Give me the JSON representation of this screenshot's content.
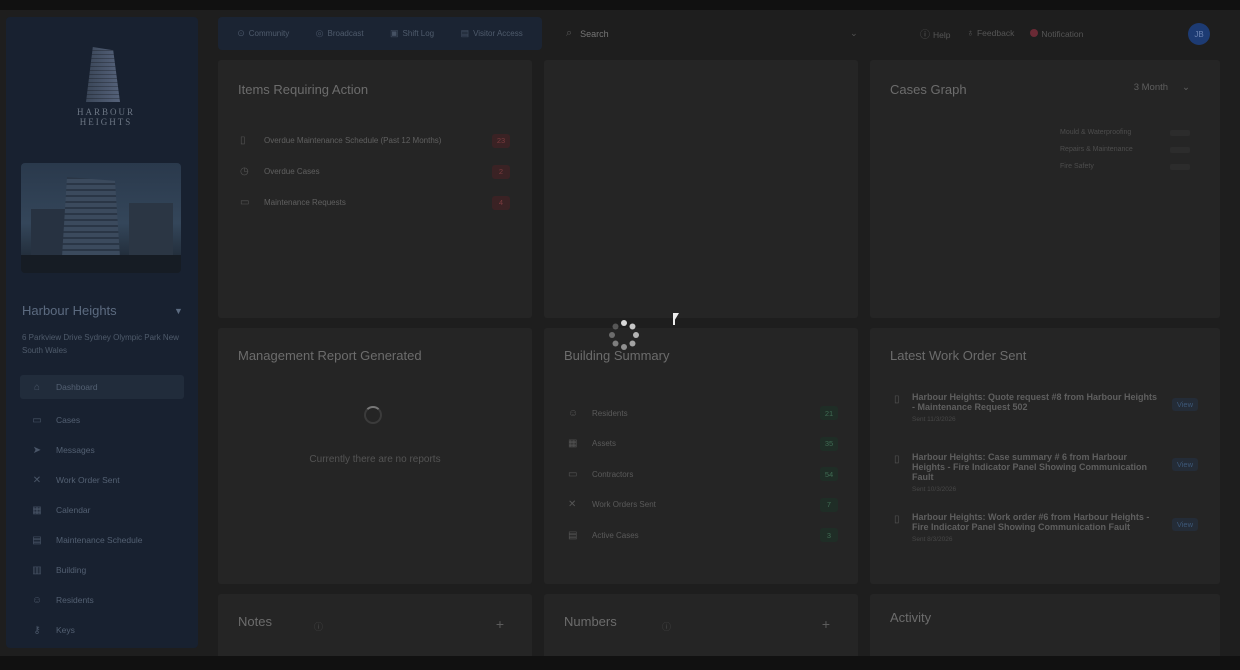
{
  "sidebar": {
    "brand_text": "HARBOUR HEIGHTS",
    "building_name": "Harbour Heights",
    "address": "6 Parkview Drive Sydney Olympic Park New South Wales",
    "items": [
      {
        "label": "Dashboard",
        "icon": "dashboard-icon",
        "glyph": "⌂"
      },
      {
        "label": "Cases",
        "icon": "briefcase-icon",
        "glyph": "▭"
      },
      {
        "label": "Messages",
        "icon": "send-icon",
        "glyph": "➤"
      },
      {
        "label": "Work Order Sent",
        "icon": "tools-icon",
        "glyph": "✕"
      },
      {
        "label": "Calendar",
        "icon": "calendar-icon",
        "glyph": "▦"
      },
      {
        "label": "Maintenance Schedule",
        "icon": "schedule-icon",
        "glyph": "▤"
      },
      {
        "label": "Building",
        "icon": "building-icon",
        "glyph": "▥"
      },
      {
        "label": "Residents",
        "icon": "residents-icon",
        "glyph": "☺"
      },
      {
        "label": "Keys",
        "icon": "key-icon",
        "glyph": "⚷"
      }
    ]
  },
  "toolbar": {
    "items": [
      {
        "label": "Community",
        "icon": "community-icon",
        "glyph": "⊙"
      },
      {
        "label": "Broadcast",
        "icon": "broadcast-icon",
        "glyph": "◎"
      },
      {
        "label": "Shift Log",
        "icon": "shift-log-icon",
        "glyph": "▣"
      },
      {
        "label": "Visitor Access",
        "icon": "visitor-icon",
        "glyph": "▤"
      }
    ]
  },
  "search": {
    "placeholder": "Search"
  },
  "topbar": {
    "help": "Help",
    "feedback": "Feedback",
    "notification": "Notification",
    "avatar_initials": "JB"
  },
  "items_requiring_action": {
    "title": "Items Requiring Action",
    "rows": [
      {
        "label": "Overdue Maintenance Schedule (Past 12 Months)",
        "count": "23",
        "icon": "document-icon",
        "glyph": "▯"
      },
      {
        "label": "Overdue Cases",
        "count": "2",
        "icon": "alarm-icon",
        "glyph": "◷"
      },
      {
        "label": "Maintenance Requests",
        "count": "4",
        "icon": "inbox-icon",
        "glyph": "▭"
      }
    ]
  },
  "cases_graph": {
    "title": "Cases Graph",
    "range": "3 Month",
    "legend": [
      "Mould & Waterproofing",
      "Repairs & Maintenance",
      "Fire Safety"
    ]
  },
  "management_report": {
    "title": "Management Report Generated",
    "empty": "Currently there are no reports"
  },
  "building_summary": {
    "title": "Building Summary",
    "rows": [
      {
        "label": "Residents",
        "count": "21",
        "icon": "residents-icon",
        "glyph": "☺"
      },
      {
        "label": "Assets",
        "count": "35",
        "icon": "assets-icon",
        "glyph": "▦"
      },
      {
        "label": "Contractors",
        "count": "54",
        "icon": "contractors-icon",
        "glyph": "▭"
      },
      {
        "label": "Work Orders Sent",
        "count": "7",
        "icon": "work-order-icon",
        "glyph": "✕"
      },
      {
        "label": "Active Cases",
        "count": "3",
        "icon": "case-icon",
        "glyph": "▤"
      }
    ]
  },
  "latest_work_order": {
    "title": "Latest Work Order Sent",
    "view_label": "View",
    "items": [
      {
        "title": "Harbour Heights: Quote request #8 from Harbour Heights - Maintenance Request 502",
        "date": "Sent 11/3/2026"
      },
      {
        "title": "Harbour Heights: Case summary # 6 from Harbour Heights - Fire Indicator Panel Showing Communication Fault",
        "date": "Sent 10/3/2026"
      },
      {
        "title": "Harbour Heights: Work order #6 from Harbour Heights - Fire Indicator Panel Showing Communication Fault",
        "date": "Sent 8/3/2026"
      }
    ]
  },
  "notes": {
    "title": "Notes"
  },
  "numbers": {
    "title": "Numbers"
  },
  "activity": {
    "title": "Activity"
  }
}
